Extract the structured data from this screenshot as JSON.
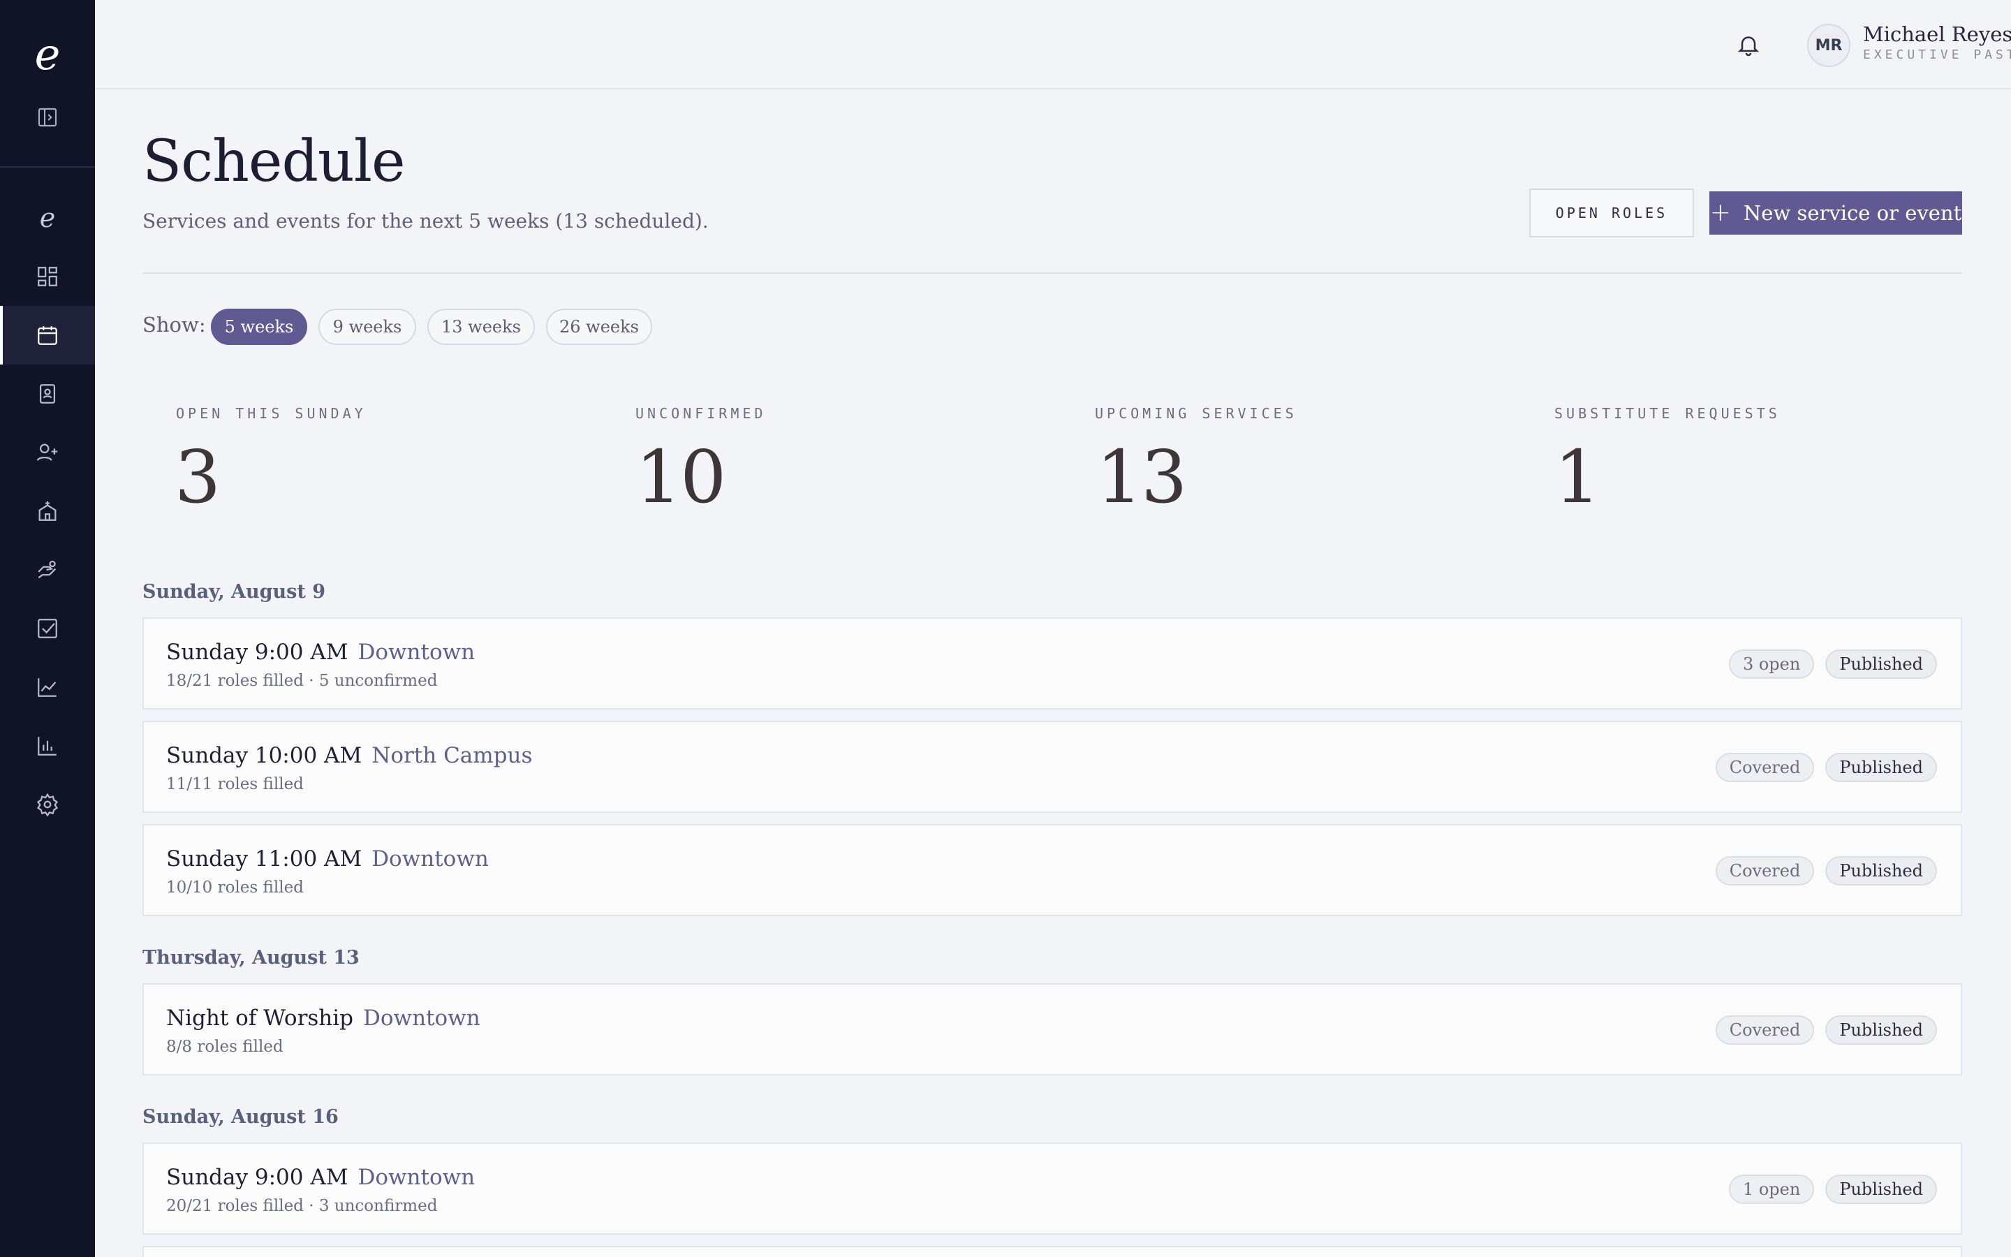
{
  "user": {
    "initials": "MR",
    "name": "Michael Reyes",
    "role": "EXECUTIVE PASTOR"
  },
  "page": {
    "title": "Schedule",
    "subtitle": "Services and events for the next 5 weeks (13 scheduled)."
  },
  "actions": {
    "open_roles": "OPEN ROLES",
    "new_event": "New service or event"
  },
  "filter": {
    "label": "Show:",
    "options": [
      "5 weeks",
      "9 weeks",
      "13 weeks",
      "26 weeks"
    ],
    "selected": "5 weeks"
  },
  "stats": [
    {
      "label": "OPEN THIS SUNDAY",
      "value": "3"
    },
    {
      "label": "UNCONFIRMED",
      "value": "10"
    },
    {
      "label": "UPCOMING SERVICES",
      "value": "13"
    },
    {
      "label": "SUBSTITUTE REQUESTS",
      "value": "1"
    }
  ],
  "days": [
    {
      "heading": "Sunday, August 9",
      "events": [
        {
          "title": "Sunday 9:00 AM",
          "location": "Downtown",
          "meta": "18/21 roles filled · 5 unconfirmed",
          "coverage": "3 open",
          "status": "Published"
        },
        {
          "title": "Sunday 10:00 AM",
          "location": "North Campus",
          "meta": "11/11 roles filled",
          "coverage": "Covered",
          "status": "Published"
        },
        {
          "title": "Sunday 11:00 AM",
          "location": "Downtown",
          "meta": "10/10 roles filled",
          "coverage": "Covered",
          "status": "Published"
        }
      ]
    },
    {
      "heading": "Thursday, August 13",
      "events": [
        {
          "title": "Night of Worship",
          "location": "Downtown",
          "meta": "8/8 roles filled",
          "coverage": "Covered",
          "status": "Published"
        }
      ]
    },
    {
      "heading": "Sunday, August 16",
      "events": [
        {
          "title": "Sunday 9:00 AM",
          "location": "Downtown",
          "meta": "20/21 roles filled · 3 unconfirmed",
          "coverage": "1 open",
          "status": "Published"
        }
      ]
    }
  ],
  "sidebar": {
    "logo": "e",
    "items": [
      {
        "name": "brand-icon",
        "active": false
      },
      {
        "name": "dashboard-icon",
        "active": false
      },
      {
        "name": "calendar-icon",
        "active": true
      },
      {
        "name": "directory-icon",
        "active": false
      },
      {
        "name": "add-person-icon",
        "active": false
      },
      {
        "name": "church-icon",
        "active": false
      },
      {
        "name": "giving-icon",
        "active": false
      },
      {
        "name": "tasks-icon",
        "active": false
      },
      {
        "name": "trends-icon",
        "active": false
      },
      {
        "name": "reports-icon",
        "active": false
      },
      {
        "name": "settings-icon",
        "active": false
      }
    ]
  },
  "colors": {
    "sidebar": "#111326",
    "accent": "#5f5b92",
    "background": "#f3f4f7"
  }
}
